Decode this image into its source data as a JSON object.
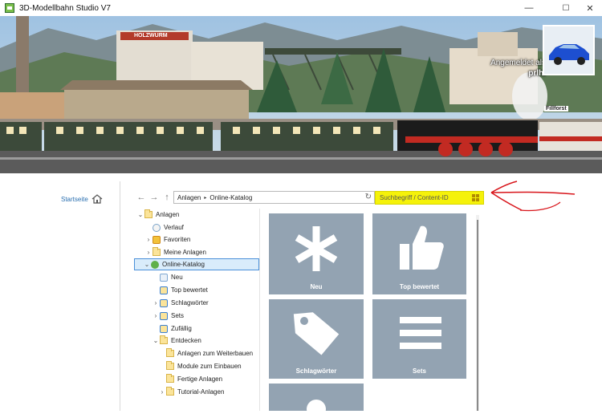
{
  "window": {
    "title": "3D-Modellbahn Studio V7",
    "controls": {
      "minimize": "—",
      "maximize": "☐",
      "close": "✕"
    }
  },
  "banner": {
    "login_line1": "Angemeldet als",
    "login_line2": "prlhi",
    "sign_holz": "HOLZWURM",
    "sign_fill": "Fillforst",
    "avatar_icon": "car-avatar-icon"
  },
  "nav": {
    "startseite": "Startseite",
    "back_glyph": "←",
    "forward_glyph": "→",
    "up_glyph": "↑",
    "path": [
      "Anlagen",
      "Online-Katalog"
    ],
    "path_separator": "▸",
    "refresh_glyph": "↻",
    "search_placeholder": "Suchbegriff / Content-ID"
  },
  "tree": [
    {
      "label": "Anlagen",
      "chev": "⌄",
      "icon": "folder-icon"
    },
    {
      "label": "Verlauf",
      "chev": "",
      "icon": "history-icon"
    },
    {
      "label": "Favoriten",
      "chev": "›",
      "icon": "favorites-icon"
    },
    {
      "label": "Meine Anlagen",
      "chev": "›",
      "icon": "folder-icon"
    },
    {
      "label": "Online-Katalog",
      "chev": "⌄",
      "icon": "globe-icon"
    },
    {
      "label": "Neu",
      "chev": "",
      "icon": "new-icon"
    },
    {
      "label": "Top bewertet",
      "chev": "",
      "icon": "thumb-icon"
    },
    {
      "label": "Schlagwörter",
      "chev": "›",
      "icon": "tag-icon"
    },
    {
      "label": "Sets",
      "chev": "›",
      "icon": "sets-icon"
    },
    {
      "label": "Zufällig",
      "chev": "",
      "icon": "random-icon"
    },
    {
      "label": "Entdecken",
      "chev": "⌄",
      "icon": "folder-icon"
    },
    {
      "label": "Anlagen zum Weiterbauen",
      "chev": "",
      "icon": "folder-icon"
    },
    {
      "label": "Module zum Einbauen",
      "chev": "",
      "icon": "folder-icon"
    },
    {
      "label": "Fertige Anlagen",
      "chev": "",
      "icon": "folder-icon"
    },
    {
      "label": "Tutorial-Anlagen",
      "chev": "›",
      "icon": "folder-icon"
    }
  ],
  "tiles": [
    {
      "label": "Neu",
      "icon": "asterisk-icon"
    },
    {
      "label": "Top bewertet",
      "icon": "thumbs-up-icon"
    },
    {
      "label": "Schlagwörter",
      "icon": "tag-icon"
    },
    {
      "label": "Sets",
      "icon": "list-icon"
    },
    {
      "label": "",
      "icon": "random-icon"
    }
  ],
  "colors": {
    "tile": "#93a3b2",
    "search_highlight": "#f5f20a",
    "annotation": "#d8141a",
    "link": "#2a6fb0"
  }
}
